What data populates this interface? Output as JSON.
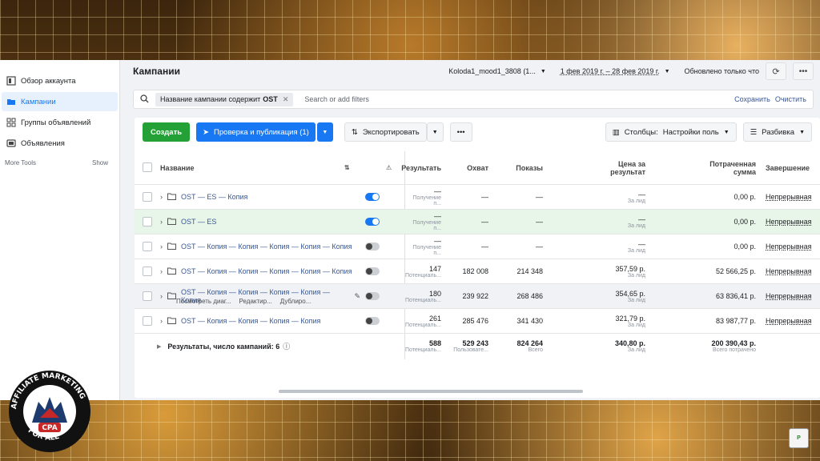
{
  "sidebar": {
    "items": [
      {
        "label": "Обзор аккаунта",
        "icon": "dashboard-icon"
      },
      {
        "label": "Кампании",
        "icon": "folder-icon",
        "active": true
      },
      {
        "label": "Группы объявлений",
        "icon": "grid-icon"
      },
      {
        "label": "Объявления",
        "icon": "ad-icon"
      }
    ],
    "more_tools": "More Tools",
    "show": "Show"
  },
  "header": {
    "title": "Кампании",
    "account": "Koloda1_mood1_3808 (1...",
    "date_range": "1 фев 2019 г. – 28 фев 2019 г.",
    "updated": "Обновлено только что"
  },
  "filter": {
    "chip_label": "Название кампании содержит",
    "chip_value": "OST",
    "placeholder": "Search or add filters",
    "save": "Сохранить",
    "clear": "Очистить"
  },
  "toolbar": {
    "create": "Создать",
    "publish": "Проверка и публикация (1)",
    "export": "Экспортировать",
    "columns_prefix": "Столбцы:",
    "columns_value": "Настройки поль",
    "breakdown": "Разбивка"
  },
  "table": {
    "headers": {
      "name": "Название",
      "results": "Результать",
      "reach": "Охват",
      "impressions": "Показы",
      "cost": "Цена за результат",
      "spend": "Потраченная сумма",
      "end": "Завершение"
    },
    "rows": [
      {
        "name": "OST — ES — Копия",
        "toggle": "on",
        "results": "—",
        "results_sub": "Получение п...",
        "reach": "—",
        "impressions": "—",
        "cost": "—",
        "cost_sub": "За лид",
        "spend": "0,00 р.",
        "end": "Непрерывная"
      },
      {
        "name": "OST — ES",
        "toggle": "on",
        "results": "—",
        "results_sub": "Получение п...",
        "reach": "—",
        "impressions": "—",
        "cost": "—",
        "cost_sub": "За лид",
        "spend": "0,00 р.",
        "end": "Непрерывная"
      },
      {
        "name": "OST — Копия — Копия — Копия — Копия — Копия",
        "toggle": "off",
        "results": "—",
        "results_sub": "Получение п...",
        "reach": "—",
        "impressions": "—",
        "cost": "—",
        "cost_sub": "За лид",
        "spend": "0,00 р.",
        "end": "Непрерывная"
      },
      {
        "name": "OST — Копия — Копия — Копия — Копия — Копия",
        "toggle": "off",
        "results": "147",
        "results_sub": "Потенциаль...",
        "reach": "182 008",
        "impressions": "214 348",
        "cost": "357,59 р.",
        "cost_sub": "За лид",
        "spend": "52 566,25 р.",
        "end": "Непрерывная"
      },
      {
        "name": "OST — Копия — Копия — Копия — Копия — Копия",
        "toggle": "off",
        "results": "180",
        "results_sub": "Потенциаль...",
        "reach": "239 922",
        "impressions": "268 486",
        "cost": "354,65 р.",
        "cost_sub": "За лид",
        "spend": "63 836,41 р.",
        "end": "Непрерывная",
        "sub_actions": [
          "Посмотреть диаг...",
          "Редактир...",
          "Дублиро..."
        ]
      },
      {
        "name": "OST — Копия — Копия — Копия — Копия",
        "toggle": "off",
        "results": "261",
        "results_sub": "Потенциаль...",
        "reach": "285 476",
        "impressions": "341 430",
        "cost": "321,79 р.",
        "cost_sub": "За лид",
        "spend": "83 987,77 р.",
        "end": "Непрерывная"
      }
    ],
    "summary": {
      "label": "Результаты, число кампаний: 6",
      "results": "588",
      "results_sub": "Потенциаль...",
      "reach": "529 243",
      "reach_sub": "Пользовате...",
      "impressions": "824 264",
      "impressions_sub": "Всего",
      "cost": "340,80 р.",
      "cost_sub": "За лид",
      "spend": "200 390,43 р.",
      "spend_sub": "Всего потрачено"
    }
  },
  "logo": {
    "text_arc": "AFFILIATE MARKETING FOR ALL",
    "center": "CPA"
  },
  "watermark": "P"
}
